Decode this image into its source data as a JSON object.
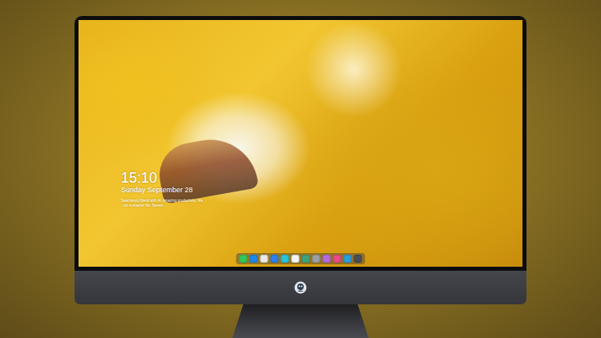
{
  "lock_screen": {
    "time": "15:10",
    "date": "Sunday September 28",
    "caption": [
      "Seamlessly blend with AI, Amazing productivity. Ma",
      "...for a smarter life. Seewo..."
    ]
  },
  "dock": {
    "items": [
      {
        "color": "#34c759"
      },
      {
        "color": "#1e88e5"
      },
      {
        "color": "#e8e8e8"
      },
      {
        "color": "#2f80ed"
      },
      {
        "color": "#27c4d8"
      },
      {
        "color": "#f4f4f4"
      },
      {
        "color": "#3fa37a"
      },
      {
        "color": "#9aa0a6"
      },
      {
        "color": "#b36ae2"
      },
      {
        "color": "#e84a8a"
      },
      {
        "color": "#2d9cdb"
      },
      {
        "color": "#4a4d55"
      }
    ]
  }
}
